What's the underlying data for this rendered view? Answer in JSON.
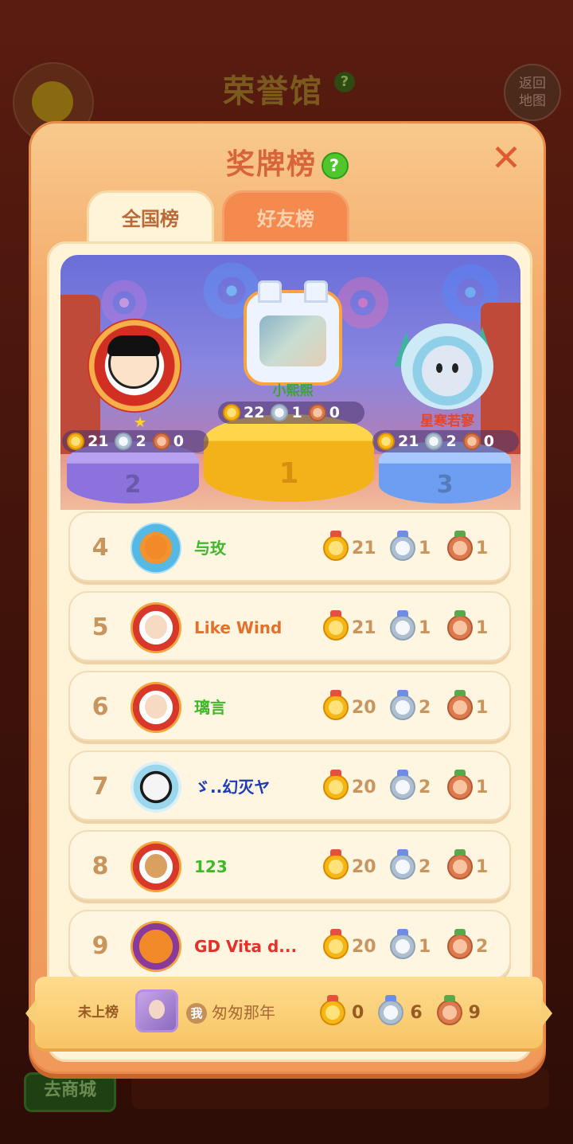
{
  "background": {
    "title": "荣誉馆",
    "back_label": "返回\n地图",
    "shop_label": "去商城"
  },
  "modal": {
    "title": "奖牌榜",
    "tabs": [
      {
        "label": "全国榜",
        "active": true
      },
      {
        "label": "好友榜",
        "active": false
      }
    ]
  },
  "podium": {
    "first": {
      "rank": "1",
      "name": "小熙熙",
      "gold": "22",
      "silver": "1",
      "bronze": "0"
    },
    "second": {
      "rank": "2",
      "name": "",
      "gold": "21",
      "silver": "2",
      "bronze": "0"
    },
    "third": {
      "rank": "3",
      "name": "星寒若寥",
      "gold": "21",
      "silver": "2",
      "bronze": "0"
    }
  },
  "leaderboard": [
    {
      "rank": "4",
      "name": "与玫",
      "name_color": "#3fb82a",
      "gold": "21",
      "silver": "1",
      "bronze": "1"
    },
    {
      "rank": "5",
      "name": "Like  Wind",
      "name_color": "#e5702a",
      "gold": "21",
      "silver": "1",
      "bronze": "1"
    },
    {
      "rank": "6",
      "name": "璃言",
      "name_color": "#3fb82a",
      "gold": "20",
      "silver": "2",
      "bronze": "1"
    },
    {
      "rank": "7",
      "name": "ゞ..幻灭ヤ",
      "name_color": "#1d3ab8",
      "gold": "20",
      "silver": "2",
      "bronze": "1"
    },
    {
      "rank": "8",
      "name": "123",
      "name_color": "#3fb82a",
      "gold": "20",
      "silver": "2",
      "bronze": "1"
    },
    {
      "rank": "9",
      "name": "GD Vita d...",
      "name_color": "#e5312a",
      "gold": "20",
      "silver": "1",
      "bronze": "2"
    }
  ],
  "self": {
    "status": "未上榜",
    "me_badge": "我",
    "name": "匆匆那年",
    "gold": "0",
    "silver": "6",
    "bronze": "9"
  },
  "colors": {
    "modal_orange": "#f3aa6a",
    "panel_cream": "#fff4d8",
    "rank_text": "#c9955e",
    "close_red": "#e05a32"
  }
}
